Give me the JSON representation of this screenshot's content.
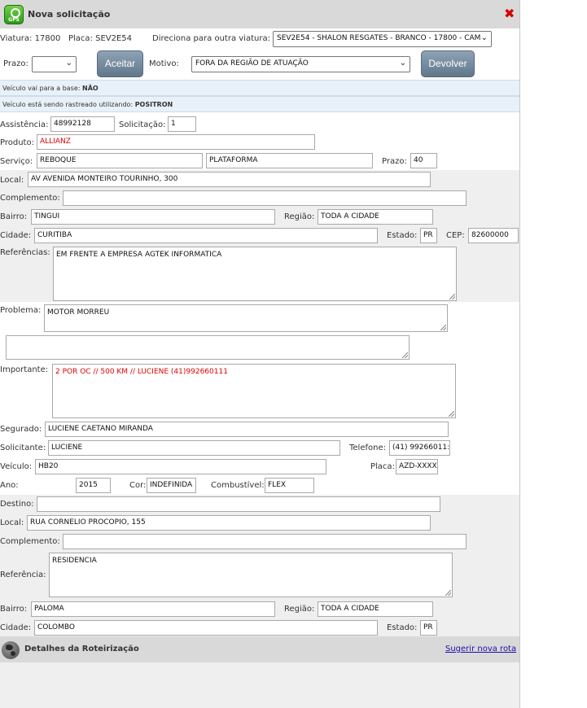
{
  "header": {
    "title": "Nova solicitação",
    "gps_label": "GPS"
  },
  "top": {
    "viatura_label": "Viatura: 17800",
    "placa_label": "Placa: SEV2E54",
    "direciona_label": "Direciona para outra viatura:",
    "direciona_value": "SEV2E54 - SHALON RESGATES - BRANCO - 17800 - CAM",
    "prazo_label": "Prazo:",
    "prazo_value": "",
    "aceitar_label": "Aceitar",
    "motivo_label": "Motivo:",
    "motivo_value": "FORA DA REGIÃO DE ATUAÇÃO",
    "devolver_label": "Devolver"
  },
  "info": {
    "base_prefix": "Veículo vai para a base:",
    "base_value": "NÃO",
    "rastreado_prefix": "Veículo está sendo rastreado utilizando:",
    "rastreado_value": "POSITRON"
  },
  "form": {
    "assistencia_label": "Assistência:",
    "assistencia_value": "48992128",
    "solicitacao_label": "Solicitação:",
    "solicitacao_value": "1",
    "produto_label": "Produto:",
    "produto_value": "ALLIANZ",
    "servico_label": "Serviço:",
    "servico_value": "REBOQUE",
    "servico2_value": "PLATAFORMA",
    "prazo_label": "Prazo:",
    "prazo_value": "40",
    "local_label": "Local:",
    "local_value": "AV AVENIDA MONTEIRO TOURINHO, 300",
    "complemento_label": "Complemento:",
    "complemento_value": "",
    "bairro_label": "Bairro:",
    "bairro_value": "TINGUI",
    "regiao_label": "Região:",
    "regiao_value": "TODA A CIDADE",
    "cidade_label": "Cidade:",
    "cidade_value": "CURITIBA",
    "estado_label": "Estado:",
    "estado_value": "PR",
    "cep_label": "CEP:",
    "cep_value": "82600000",
    "referencias_label": "Referências:",
    "referencias_value": "EM FRENTE A EMPRESA AGTEK INFORMATICA",
    "problema_label": "Problema:",
    "problema_value": "MOTOR MORREU",
    "problema2_value": "",
    "importante_label": "Importante:",
    "importante_value": "2 POR OC // 500 KM // LUCIENE (41)992660111",
    "segurado_label": "Segurado:",
    "segurado_value": "LUCIENE CAETANO MIRANDA",
    "solicitante_label": "Solicitante:",
    "solicitante_value": "LUCIENE",
    "telefone_label": "Telefone:",
    "telefone_value": "(41) 99266011:",
    "veiculo_label": "Veículo:",
    "veiculo_value": "HB20",
    "placa_label": "Placa:",
    "placa_value": "AZD-XXXX",
    "ano_label": "Ano:",
    "ano_value": "2015",
    "cor_label": "Cor:",
    "cor_value": "INDEFINIDA",
    "combustivel_label": "Combustível:",
    "combustivel_value": "FLEX"
  },
  "destino": {
    "destino_label": "Destino:",
    "destino_value": "",
    "local_label": "Local:",
    "local_value": "RUA CORNELIO PROCOPIO, 155",
    "complemento_label": "Complemento:",
    "complemento_value": "",
    "referencia_label": "Referência:",
    "referencia_value": "RESIDENCIA",
    "bairro_label": "Bairro:",
    "bairro_value": "PALOMA",
    "regiao_label": "Região:",
    "regiao_value": "TODA A CIDADE",
    "cidade_label": "Cidade:",
    "cidade_value": "COLOMBO",
    "estado_label": "Estado:",
    "estado_value": "PR"
  },
  "footer": {
    "title": "Detalhes da Roteirização",
    "link": "Sugerir nova rota"
  },
  "icons": {
    "app": "gps-icon",
    "close": "close-icon",
    "route": "globe-icon"
  },
  "colors": {
    "accent_red": "#e00000",
    "button": "#6f8699",
    "info_bg": "#e8f1f9"
  }
}
